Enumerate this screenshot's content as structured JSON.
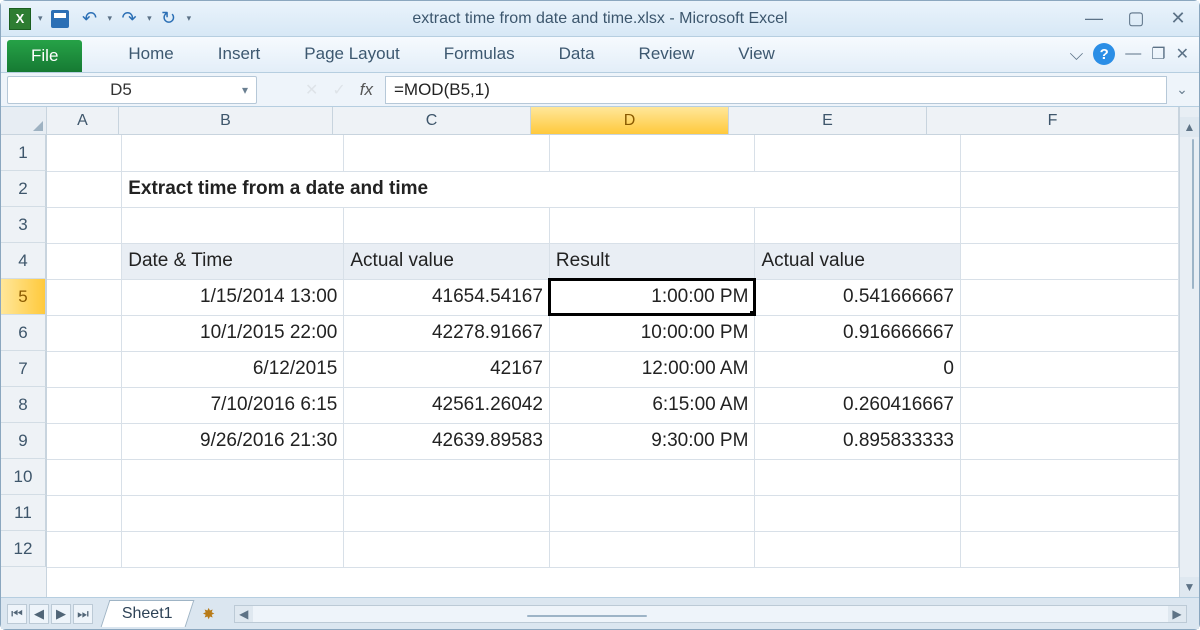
{
  "window": {
    "title": "extract time from date and time.xlsx  -  Microsoft Excel"
  },
  "ribbon": {
    "file": "File",
    "tabs": [
      "Home",
      "Insert",
      "Page Layout",
      "Formulas",
      "Data",
      "Review",
      "View"
    ]
  },
  "namebox": "D5",
  "fx_label": "fx",
  "formula": "=MOD(B5,1)",
  "columns": [
    "A",
    "B",
    "C",
    "D",
    "E",
    "F"
  ],
  "active_col": "D",
  "rows": [
    "1",
    "2",
    "3",
    "4",
    "5",
    "6",
    "7",
    "8",
    "9",
    "10",
    "11",
    "12"
  ],
  "active_row": "5",
  "heading": "Extract time from a date and time",
  "table": {
    "headers": [
      "Date & Time",
      "Actual value",
      "Result",
      "Actual value"
    ],
    "rows": [
      {
        "b": "1/15/2014 13:00",
        "c": "41654.54167",
        "d": "1:00:00 PM",
        "e": "0.541666667"
      },
      {
        "b": "10/1/2015 22:00",
        "c": "42278.91667",
        "d": "10:00:00 PM",
        "e": "0.916666667"
      },
      {
        "b": "6/12/2015",
        "c": "42167",
        "d": "12:00:00 AM",
        "e": "0"
      },
      {
        "b": "7/10/2016 6:15",
        "c": "42561.26042",
        "d": "6:15:00 AM",
        "e": "0.260416667"
      },
      {
        "b": "9/26/2016 21:30",
        "c": "42639.89583",
        "d": "9:30:00 PM",
        "e": "0.895833333"
      }
    ]
  },
  "sheet_tab": "Sheet1"
}
